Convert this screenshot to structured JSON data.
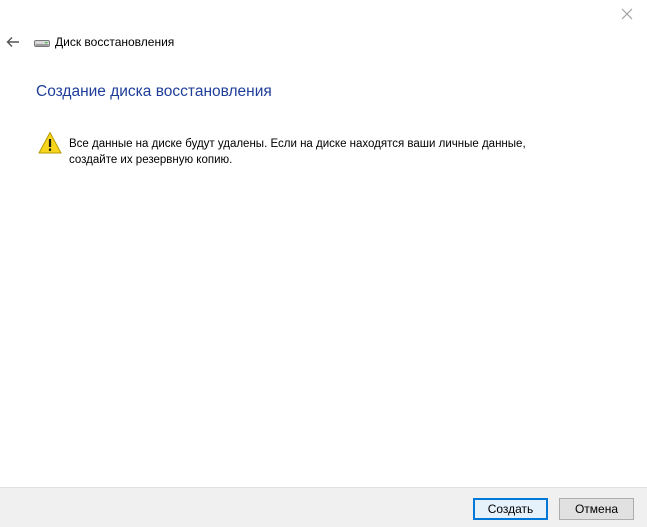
{
  "window": {
    "title": "Диск восстановления"
  },
  "page": {
    "heading": "Создание диска восстановления",
    "warning_line1": "Все данные на диске будут удалены. Если на диске находятся ваши личные данные,",
    "warning_line2": "создайте их резервную копию."
  },
  "buttons": {
    "create_label": "Создать",
    "cancel_label": "Отмена"
  },
  "icons": {
    "back": "arrow-left-icon",
    "drive": "drive-icon",
    "warning": "warning-icon",
    "close": "close-icon"
  },
  "colors": {
    "heading": "#1e3e9a",
    "warning_fill": "#f7d51d",
    "primary_border": "#0078d7"
  }
}
